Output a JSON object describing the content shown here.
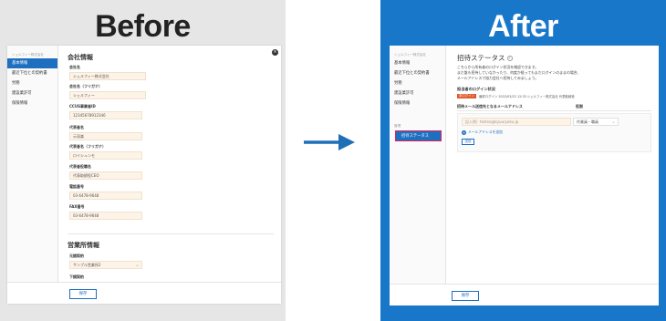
{
  "before": {
    "title": "Before",
    "sidebar": {
      "company": "シェルフィー株式会社",
      "items": [
        "基本情報",
        "最近下位との契約書",
        "労務",
        "建設業許可",
        "保険情報"
      ]
    },
    "section1": "会社情報",
    "fields": [
      {
        "label": "会社名",
        "value": "シェルフィー株式会社"
      },
      {
        "label": "会社名（フリガナ）",
        "value": "シェルフィー"
      },
      {
        "label": "CCUS事業者ID",
        "value": "12345678912346"
      },
      {
        "label": "代表者名",
        "value": "示深楽"
      },
      {
        "label": "代表者名（フリガナ）",
        "value": "ロイシュンモ"
      },
      {
        "label": "代表者役職名",
        "value": "代表取締役CEO"
      },
      {
        "label": "電話番号",
        "value": "03-6478-9648"
      },
      {
        "label": "FAX番号",
        "value": "03-6478-9648"
      }
    ],
    "section2": "営業所情報",
    "office_label": "元請契約",
    "office_value": "サンプル営業所2",
    "sub_label": "下請契約",
    "save": "保存",
    "close": "×"
  },
  "after": {
    "title": "After",
    "sidebar": {
      "company": "シェルフィー株式会社",
      "items": [
        "基本情報",
        "最近下位との契約書",
        "労務",
        "建設業許可",
        "保険情報"
      ],
      "section": "管理",
      "invite": "招待ステータス"
    },
    "heading": "招待ステータス",
    "help_icon": "?",
    "intro": [
      "こちらから所有者のログイン状況を確認できます。",
      "まだ誰も招待していなかったり、何度か経ってもまだログインのままの場合、",
      "メールアドレスで協力会社へ招待してみましょう。"
    ],
    "login_title": "担当者のログイン状況",
    "login_badge": "未ログイン",
    "login_detail": "最終ログイン 2022/03/22 12:33 シェルフィー株式会社 代表取締役",
    "form_header_email": "招待メール送信先となるメールアドレス",
    "form_header_role": "役割",
    "email_placeholder": "記入例）testxx@kyuuryoku.jp",
    "role_value": "作業員・職員",
    "add_link": "メールアドレスを追加",
    "send_button": "送信",
    "save": "保存",
    "close": "×"
  }
}
